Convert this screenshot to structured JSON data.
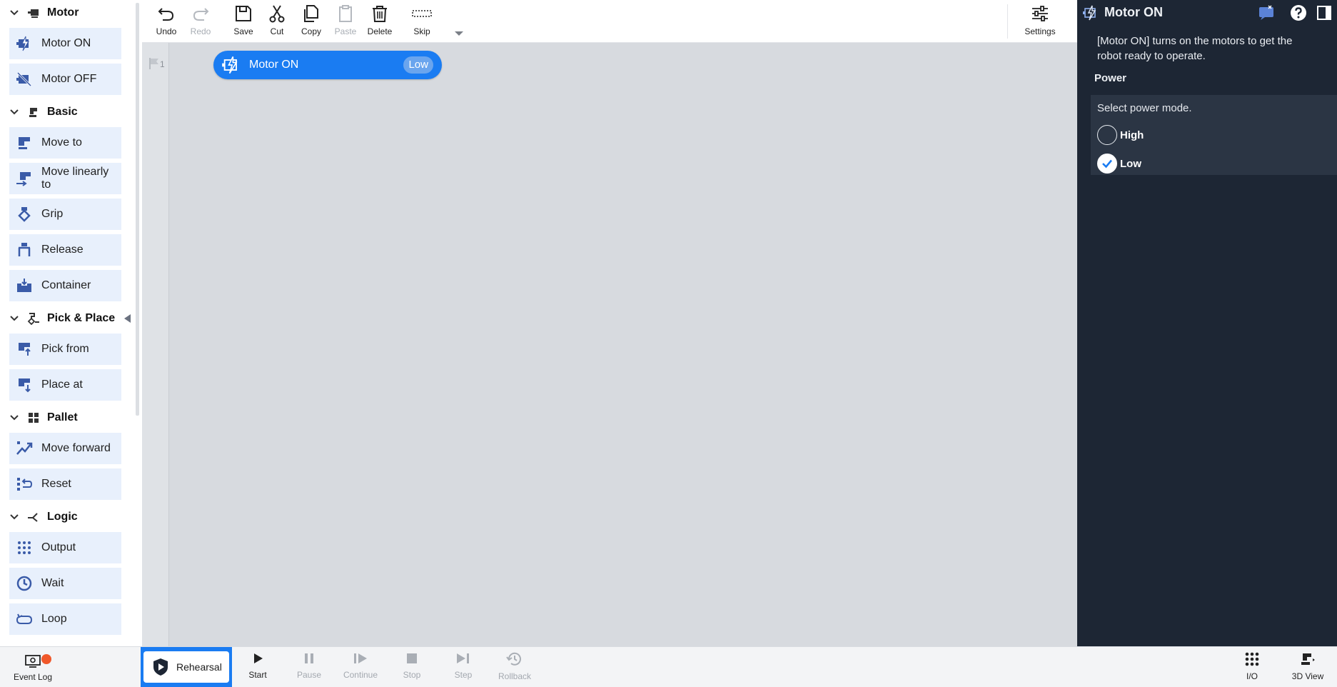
{
  "palette": {
    "categories": {
      "motor": "Motor",
      "basic": "Basic",
      "pickplace": "Pick & Place",
      "pallet": "Pallet",
      "logic": "Logic"
    },
    "items": {
      "motor_on": "Motor ON",
      "motor_off": "Motor OFF",
      "move_to": "Move to",
      "move_linearly": "Move linearly to",
      "grip": "Grip",
      "release": "Release",
      "container": "Container",
      "pick_from": "Pick from",
      "place_at": "Place at",
      "move_forward": "Move forward",
      "reset": "Reset",
      "output": "Output",
      "wait": "Wait",
      "loop": "Loop"
    }
  },
  "toolbar": {
    "undo": "Undo",
    "redo": "Redo",
    "save": "Save",
    "cut": "Cut",
    "copy": "Copy",
    "paste": "Paste",
    "delete": "Delete",
    "skip": "Skip",
    "settings": "Settings"
  },
  "canvas": {
    "line_number": "1",
    "block": {
      "label": "Motor ON",
      "badge": "Low"
    }
  },
  "panel": {
    "title": "Motor ON",
    "description": "[Motor ON] turns on the motors to get the robot ready to operate.",
    "section": "Power",
    "prompt": "Select power mode.",
    "options": [
      "High",
      "Low"
    ],
    "selected": "Low"
  },
  "bottom": {
    "event_log": "Event Log",
    "rehearsal": "Rehearsal",
    "start": "Start",
    "pause": "Pause",
    "continue": "Continue",
    "stop": "Stop",
    "step": "Step",
    "rollback": "Rollback",
    "io": "I/O",
    "view3d": "3D View"
  },
  "colors": {
    "accent": "#1a7cf2",
    "panel_bg": "#1d2634",
    "item_bg": "#e8f0fc",
    "icon_blue": "#3a5ba8",
    "notification": "#f0582a"
  }
}
